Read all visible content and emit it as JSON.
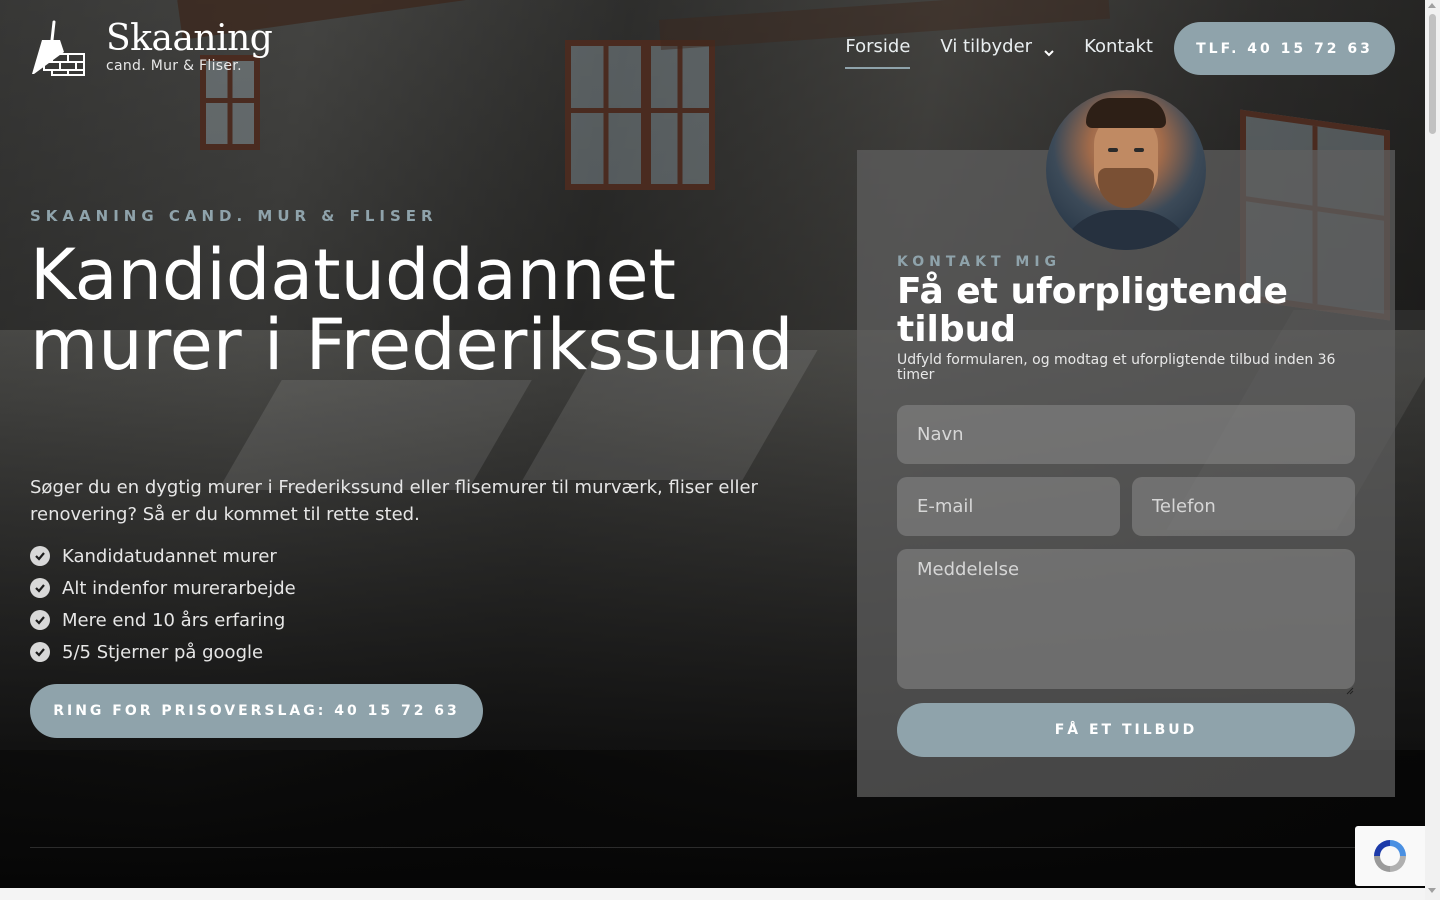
{
  "brand": {
    "name": "Skaaning",
    "tagline": "cand. Mur & Fliser."
  },
  "nav": {
    "items": [
      {
        "label": "Forside",
        "active": true
      },
      {
        "label": "Vi tilbyder",
        "has_dropdown": true
      },
      {
        "label": "Kontakt"
      }
    ],
    "cta_label": "TLF. 40 15 72 63"
  },
  "hero": {
    "eyebrow": "SKAANING CAND. MUR & FLISER",
    "title": "Kandidatuddannet murer i Frederikssund",
    "text": "Søger du en dygtig murer i Frederikssund eller flisemurer til murværk, fliser eller renovering? Så er du kommet til rette sted.",
    "checklist": [
      "Kandidatudannet murer",
      "Alt indenfor murerarbejde",
      "Mere end 10 års erfaring",
      "5/5 Stjerner på google"
    ],
    "cta_label": "RING FOR PRISOVERSLAG: 40 15 72 63"
  },
  "form": {
    "eyebrow": "KONTAKT MIG",
    "title": "Få et uforpligtende tilbud",
    "subtitle": "Udfyld formularen, og modtag et uforpligtende tilbud inden 36 timer",
    "fields": {
      "name_placeholder": "Navn",
      "email_placeholder": "E-mail",
      "phone_placeholder": "Telefon",
      "message_placeholder": "Meddelelse"
    },
    "submit_label": "FÅ ET TILBUD"
  },
  "colors": {
    "accent": "#8fa3ab",
    "card": "#5f5f5f",
    "text": "#ffffff"
  },
  "icons": {
    "check": "check-circle-icon",
    "chevron": "chevron-down-icon",
    "logo": "trowel-brick-logo",
    "recaptcha": "recaptcha-icon"
  }
}
